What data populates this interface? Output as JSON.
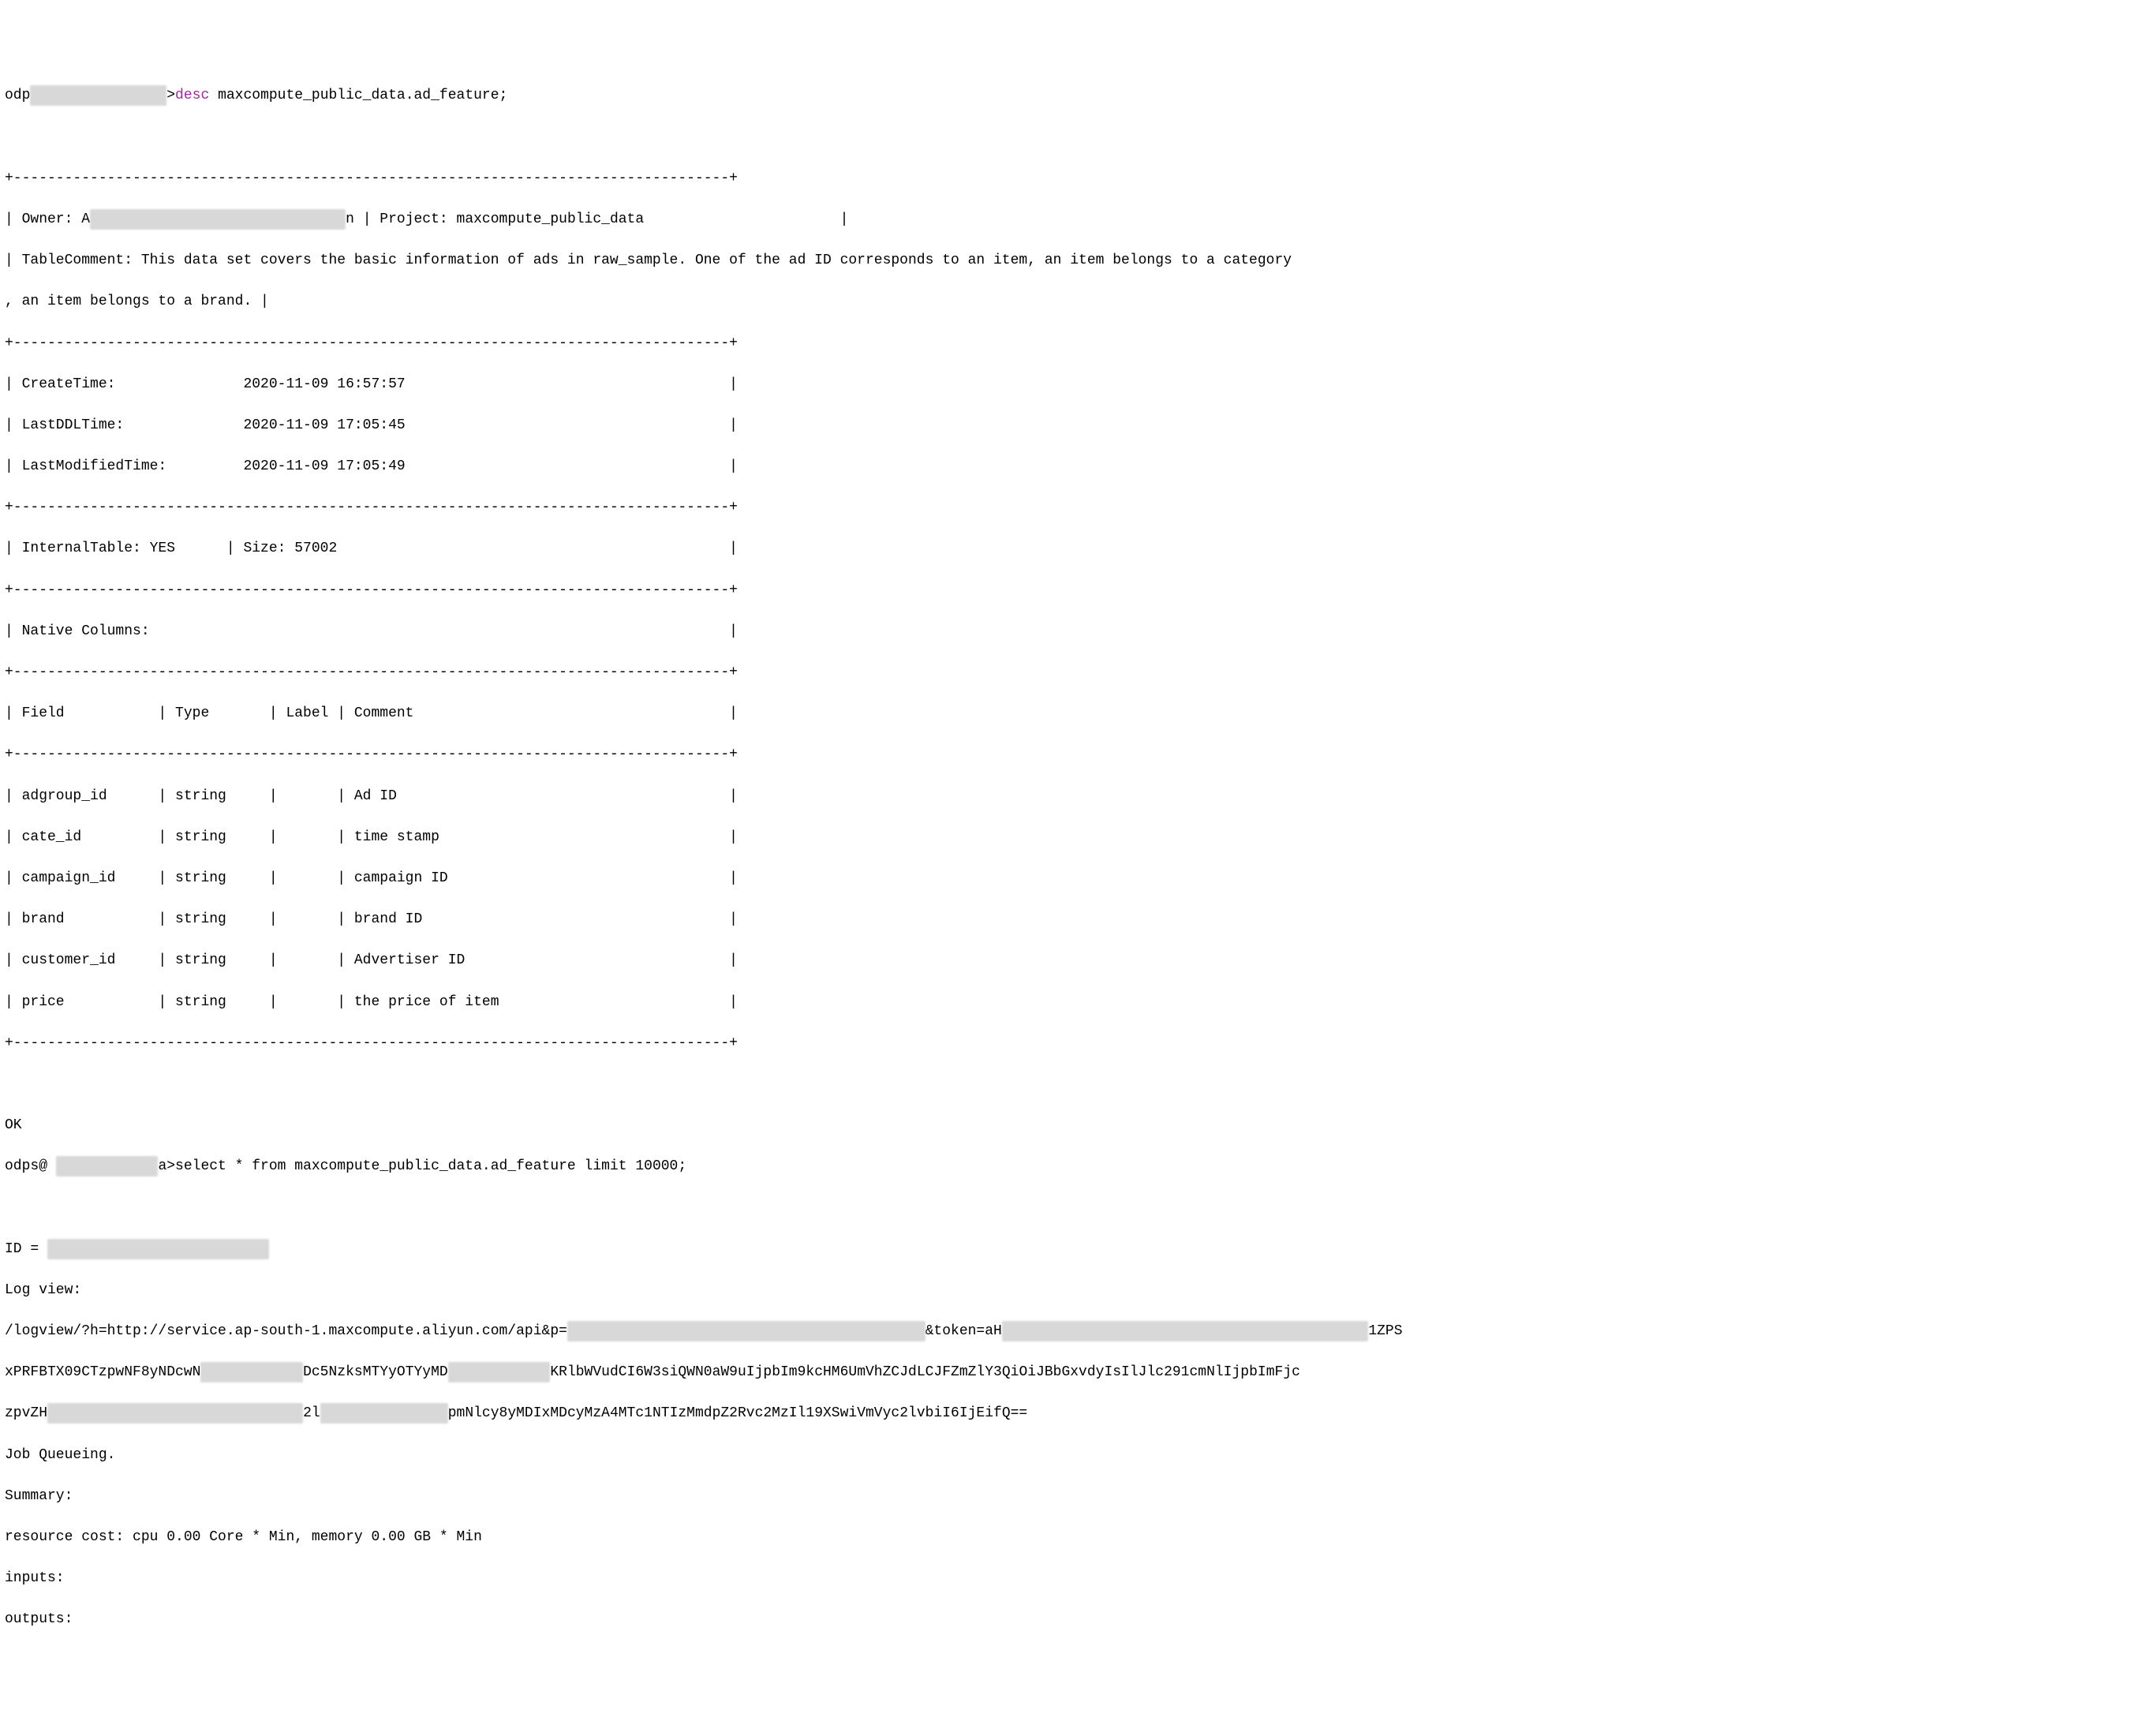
{
  "prompt1_prefix": "odp",
  "prompt1_redacted": "xxxxxxxxxxxxxxxx",
  "prompt1_gt": ">",
  "desc_keyword": "desc",
  "desc_arg": " maxcompute_public_data.ad_feature;",
  "divider1": "+------------------------------------------------------------------------------------+",
  "owner_line_prefix": "| Owner: A",
  "owner_redacted": "xxxxxxxxxxxxxxxxxxxxxxxxxxxxxx",
  "owner_line_rest": "n | Project: maxcompute_public_data                       |",
  "tablecomment_line1": "| TableComment: This data set covers the basic information of ads in raw_sample. One of the ad ID corresponds to an item, an item belongs to a category",
  "tablecomment_line2": ", an item belongs to a brand. |",
  "divider2": "+------------------------------------------------------------------------------------+",
  "createtime_line": "| CreateTime:               2020-11-09 16:57:57                                      |",
  "lastddl_line": "| LastDDLTime:              2020-11-09 17:05:45                                      |",
  "lastmodified_line": "| LastModifiedTime:         2020-11-09 17:05:49                                      |",
  "divider3": "+------------------------------------------------------------------------------------+",
  "internaltable_line": "| InternalTable: YES      | Size: 57002                                              |",
  "divider4": "+------------------------------------------------------------------------------------+",
  "nativecolumns_line": "| Native Columns:                                                                    |",
  "divider5": "+------------------------------------------------------------------------------------+",
  "header_line": "| Field           | Type       | Label | Comment                                     |",
  "divider6": "+------------------------------------------------------------------------------------+",
  "row_adgroup": "| adgroup_id      | string     |       | Ad ID                                       |",
  "row_cate": "| cate_id         | string     |       | time stamp                                  |",
  "row_campaign": "| campaign_id     | string     |       | campaign ID                                 |",
  "row_brand": "| brand           | string     |       | brand ID                                    |",
  "row_customer": "| customer_id     | string     |       | Advertiser ID                               |",
  "row_price": "| price           | string     |       | the price of item                           |",
  "divider7": "+------------------------------------------------------------------------------------+",
  "ok_line": "OK",
  "prompt2_prefix": "odps@ ",
  "prompt2_redacted": "xxxxxxxxxxxx",
  "prompt2_rest": "a>select * from maxcompute_public_data.ad_feature limit 10000;",
  "id_prefix": "ID = ",
  "id_redacted": "xxxxxxxxxxxxxxxxxxxxxxxxxx",
  "logview_label": "Log view:",
  "logview_l1_a": "/logview/?h=http://service.ap-south-1.maxcompute.aliyun.com/api&p=",
  "logview_l1_r1": "xxxxxxxxxxxxxxxxxxxxxxxxxxxxxxxxxxxxxxxxxx",
  "logview_l1_b": "&token=aH",
  "logview_l1_r2": "xxxxxxxxxxxxxxxxxxxxxxxxxxxxxxxxxxxxxxxxxxx",
  "logview_l1_c": "1ZPS",
  "logview_l2_a": "xPRFBTX09CTzpwNF8yNDcwN",
  "logview_l2_r1": "xxxxxxxxxxxx",
  "logview_l2_b": "Dc5NzksMTYyOTYyMD",
  "logview_l2_r2": "xxxxxxxxxxxx",
  "logview_l2_c": "KRlbWVudCI6W3siQWN0aW9uIjpbIm9kcHM6UmVhZCJdLCJFZmZlY3QiOiJBbGxvdyIsIlJlc291cmNlIjpbImFjc",
  "logview_l3_a": "zpvZH",
  "logview_l3_r1": "xxxxxxxxxxxxxxxxxxxxxxxxxxxxxx",
  "logview_l3_b": "2l",
  "logview_l3_r2": "xxxxxxxxxxxxxxx",
  "logview_l3_c": "pmNlcy8yMDIxMDcyMzA4MTc1NTIzMmdpZ2Rvc2MzIl19XSwiVmVyc2lvbiI6IjEifQ==",
  "jobqueue": "Job Queueing.",
  "summary": "Summary:",
  "resourcecost": "resource cost: cpu 0.00 Core * Min, memory 0.00 GB * Min",
  "inputs": "inputs:",
  "outputs": "outputs:"
}
